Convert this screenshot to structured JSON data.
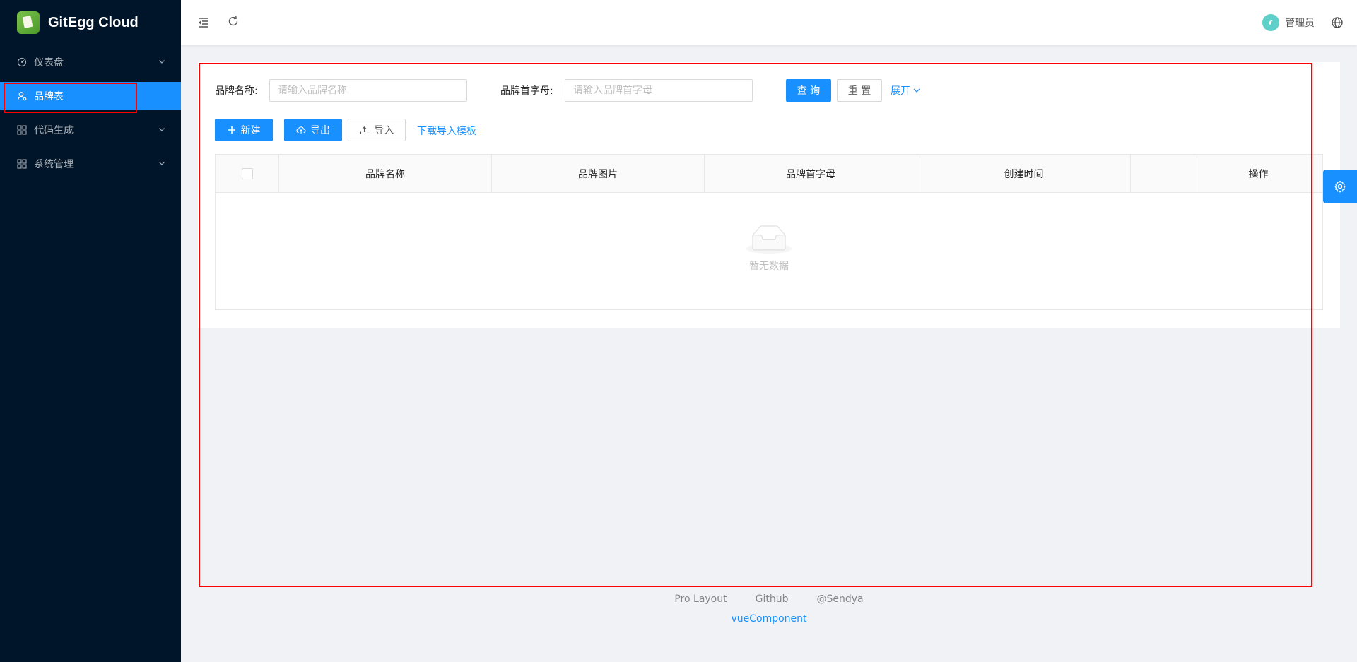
{
  "app": {
    "title": "GitEgg Cloud"
  },
  "sidebar": {
    "items": [
      {
        "label": "仪表盘",
        "icon": "dashboard-icon",
        "expandable": true
      },
      {
        "label": "品牌表",
        "icon": "user-icon",
        "active": true
      },
      {
        "label": "代码生成",
        "icon": "appstore-icon",
        "expandable": true
      },
      {
        "label": "系统管理",
        "icon": "appstore-icon",
        "expandable": true
      }
    ]
  },
  "header": {
    "user_name": "管理员",
    "icons": [
      "menu-fold-icon",
      "reload-icon",
      "globe-icon"
    ]
  },
  "search": {
    "brand_name_label": "品牌名称:",
    "brand_name_placeholder": "请输入品牌名称",
    "brand_initial_label": "品牌首字母:",
    "brand_initial_placeholder": "请输入品牌首字母",
    "query_label": "查 询",
    "reset_label": "重 置",
    "expand_label": "展开"
  },
  "toolbar": {
    "new_label": "新建",
    "export_label": "导出",
    "import_label": "导入",
    "download_template_label": "下载导入模板"
  },
  "table": {
    "columns": [
      "品牌名称",
      "品牌图片",
      "品牌首字母",
      "创建时间",
      "",
      "操作"
    ],
    "empty_text": "暂无数据"
  },
  "footer": {
    "links": [
      "Pro Layout",
      "Github",
      "@Sendya"
    ],
    "copyright": "vueComponent"
  },
  "colors": {
    "primary": "#1890ff",
    "sider": "#001529",
    "highlight": "#ff0000"
  }
}
